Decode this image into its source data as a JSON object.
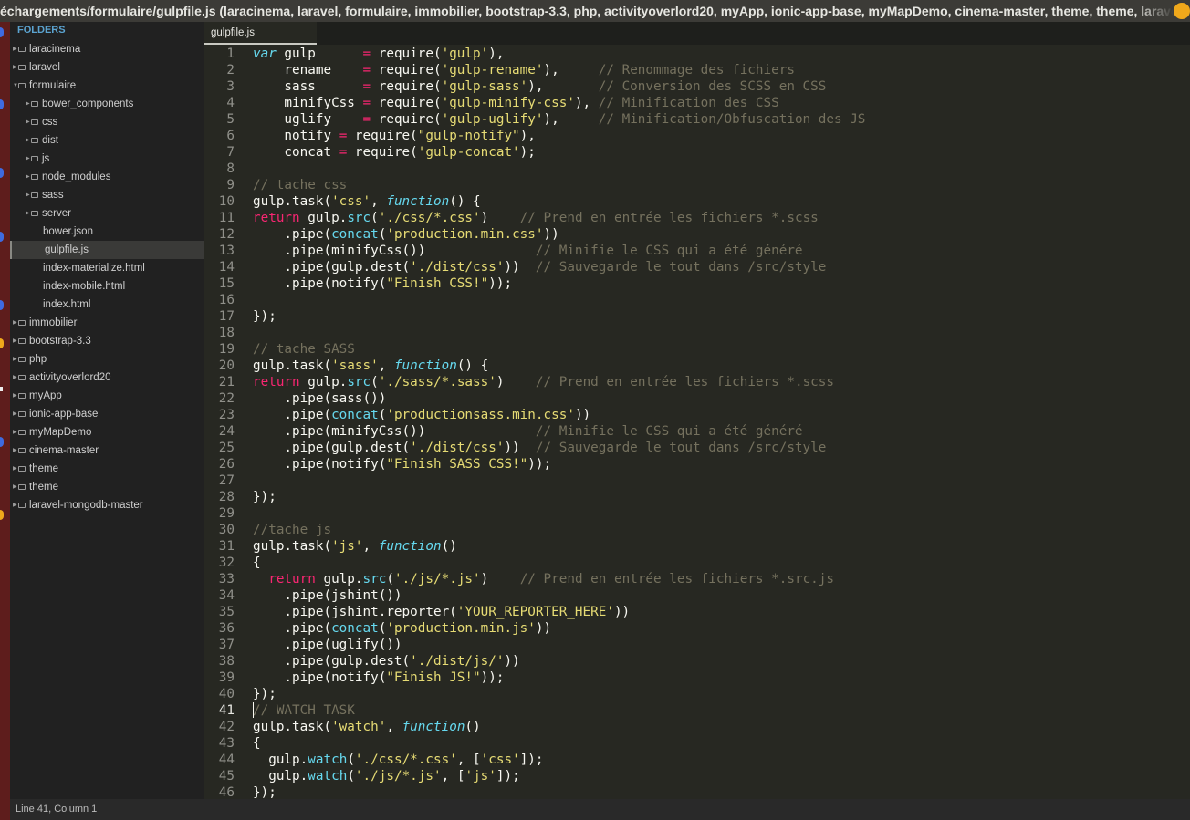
{
  "window": {
    "title": "échargements/formulaire/gulpfile.js (laracinema, laravel, formulaire, immobilier, bootstrap-3.3, php, activityoverlord20, myApp, ionic-app-base, myMapDemo, cinema-master, theme, theme, laravel-mongodb-master)"
  },
  "sidebar": {
    "header": "FOLDERS",
    "items": [
      {
        "label": "laracinema",
        "depth": 0,
        "type": "folder",
        "expanded": false,
        "selected": false
      },
      {
        "label": "laravel",
        "depth": 0,
        "type": "folder",
        "expanded": false,
        "selected": false
      },
      {
        "label": "formulaire",
        "depth": 0,
        "type": "folder",
        "expanded": true,
        "selected": false
      },
      {
        "label": "bower_components",
        "depth": 1,
        "type": "folder",
        "expanded": false,
        "selected": false
      },
      {
        "label": "css",
        "depth": 1,
        "type": "folder",
        "expanded": false,
        "selected": false
      },
      {
        "label": "dist",
        "depth": 1,
        "type": "folder",
        "expanded": false,
        "selected": false
      },
      {
        "label": "js",
        "depth": 1,
        "type": "folder",
        "expanded": false,
        "selected": false
      },
      {
        "label": "node_modules",
        "depth": 1,
        "type": "folder",
        "expanded": false,
        "selected": false
      },
      {
        "label": "sass",
        "depth": 1,
        "type": "folder",
        "expanded": false,
        "selected": false
      },
      {
        "label": "server",
        "depth": 1,
        "type": "folder",
        "expanded": false,
        "selected": false
      },
      {
        "label": "bower.json",
        "depth": 1,
        "type": "file",
        "expanded": false,
        "selected": false
      },
      {
        "label": "gulpfile.js",
        "depth": 1,
        "type": "file",
        "expanded": false,
        "selected": true
      },
      {
        "label": "index-materialize.html",
        "depth": 1,
        "type": "file",
        "expanded": false,
        "selected": false
      },
      {
        "label": "index-mobile.html",
        "depth": 1,
        "type": "file",
        "expanded": false,
        "selected": false
      },
      {
        "label": "index.html",
        "depth": 1,
        "type": "file",
        "expanded": false,
        "selected": false
      },
      {
        "label": "immobilier",
        "depth": 0,
        "type": "folder",
        "expanded": false,
        "selected": false
      },
      {
        "label": "bootstrap-3.3",
        "depth": 0,
        "type": "folder",
        "expanded": false,
        "selected": false
      },
      {
        "label": "php",
        "depth": 0,
        "type": "folder",
        "expanded": false,
        "selected": false
      },
      {
        "label": "activityoverlord20",
        "depth": 0,
        "type": "folder",
        "expanded": false,
        "selected": false
      },
      {
        "label": "myApp",
        "depth": 0,
        "type": "folder",
        "expanded": false,
        "selected": false
      },
      {
        "label": "ionic-app-base",
        "depth": 0,
        "type": "folder",
        "expanded": false,
        "selected": false
      },
      {
        "label": "myMapDemo",
        "depth": 0,
        "type": "folder",
        "expanded": false,
        "selected": false
      },
      {
        "label": "cinema-master",
        "depth": 0,
        "type": "folder",
        "expanded": false,
        "selected": false
      },
      {
        "label": "theme",
        "depth": 0,
        "type": "folder",
        "expanded": false,
        "selected": false
      },
      {
        "label": "theme",
        "depth": 0,
        "type": "folder",
        "expanded": false,
        "selected": false
      },
      {
        "label": "laravel-mongodb-master",
        "depth": 0,
        "type": "folder",
        "expanded": false,
        "selected": false
      }
    ]
  },
  "tabs": [
    {
      "label": "gulpfile.js",
      "active": true
    }
  ],
  "editor": {
    "current_line": 41,
    "lines": [
      "var gulp      = require('gulp'),",
      "    rename    = require('gulp-rename'),     // Renommage des fichiers",
      "    sass      = require('gulp-sass'),       // Conversion des SCSS en CSS",
      "    minifyCss = require('gulp-minify-css'), // Minification des CSS",
      "    uglify    = require('gulp-uglify'),     // Minification/Obfuscation des JS",
      "    notify = require(\"gulp-notify\"),",
      "    concat = require('gulp-concat');",
      "",
      "// tache css",
      "gulp.task('css', function() {",
      "return gulp.src('./css/*.css')    // Prend en entrée les fichiers *.scss",
      "    .pipe(concat('production.min.css'))",
      "    .pipe(minifyCss())              // Minifie le CSS qui a été généré",
      "    .pipe(gulp.dest('./dist/css'))  // Sauvegarde le tout dans /src/style",
      "    .pipe(notify(\"Finish CSS!\"));",
      "",
      "});",
      "",
      "// tache SASS",
      "gulp.task('sass', function() {",
      "return gulp.src('./sass/*.sass')    // Prend en entrée les fichiers *.scss",
      "    .pipe(sass())",
      "    .pipe(concat('productionsass.min.css'))",
      "    .pipe(minifyCss())              // Minifie le CSS qui a été généré",
      "    .pipe(gulp.dest('./dist/css'))  // Sauvegarde le tout dans /src/style",
      "    .pipe(notify(\"Finish SASS CSS!\"));",
      "",
      "});",
      "",
      "//tache js",
      "gulp.task('js', function()",
      "{",
      "  return gulp.src('./js/*.js')    // Prend en entrée les fichiers *.src.js",
      "    .pipe(jshint())",
      "    .pipe(jshint.reporter('YOUR_REPORTER_HERE'))",
      "    .pipe(concat('production.min.js'))",
      "    .pipe(uglify())",
      "    .pipe(gulp.dest('./dist/js/'))",
      "    .pipe(notify(\"Finish JS!\"));",
      "});",
      "// WATCH TASK",
      "gulp.task('watch', function()",
      "{",
      "  gulp.watch('./css/*.css', ['css']);",
      "  gulp.watch('./js/*.js', ['js']);",
      "});"
    ]
  },
  "colors": {
    "keyword": "#f92672",
    "string": "#e6db74",
    "function": "#66d9ef",
    "comment": "#75715e",
    "text": "#f8f8f2",
    "background": "#272822"
  },
  "statusbar": {
    "position": "Line 41, Column 1"
  }
}
